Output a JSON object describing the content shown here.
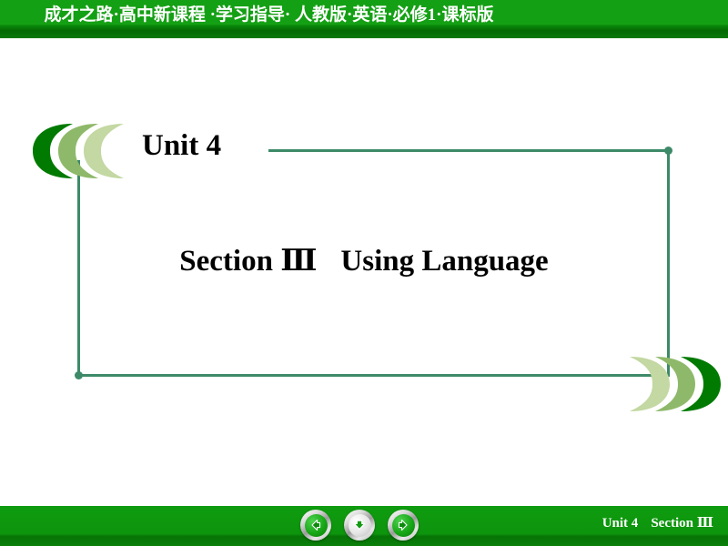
{
  "header": {
    "title": "成才之路·高中新课程 ·学习指导· 人教版·英语·必修1·课标版",
    "bg_color": "#14a014"
  },
  "slide": {
    "unit_label": "Unit 4",
    "section_title": "Section Ⅲ",
    "section_subtitle": "Using Language",
    "frame_color": "#3d8a68"
  },
  "decor": {
    "chevron_left_name": "chevron-left-decor",
    "chevron_right_name": "chevron-right-decor",
    "color_dark": "#007a00",
    "color_mid": "#8fb96a",
    "color_light": "#c3d8a2"
  },
  "footer": {
    "unit_label": "Unit 4",
    "section_label": "Section Ⅲ",
    "bg_color": "#0f9b0f",
    "buttons": [
      {
        "name": "previous-slide-button",
        "icon": "arrow-left-icon",
        "glyph": "◀",
        "style": "green"
      },
      {
        "name": "down-slide-button",
        "icon": "arrow-down-icon",
        "glyph": "▼",
        "style": "silver"
      },
      {
        "name": "next-slide-button",
        "icon": "arrow-right-icon",
        "glyph": "▶",
        "style": "green"
      }
    ]
  }
}
